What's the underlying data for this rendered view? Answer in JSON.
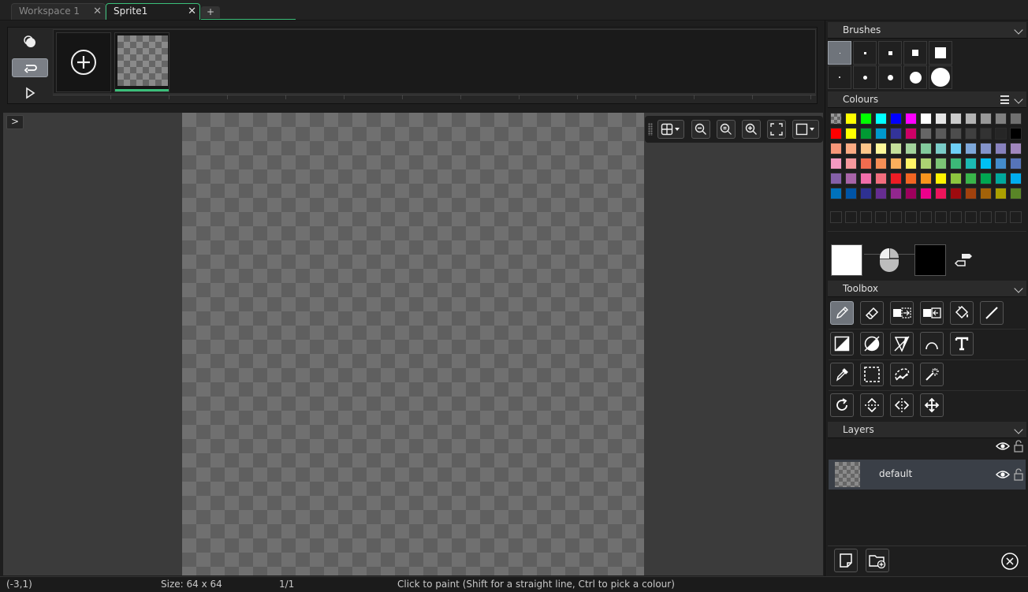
{
  "tabs": [
    {
      "label": "Workspace 1",
      "active": false
    },
    {
      "label": "Sprite1",
      "active": true
    }
  ],
  "tab_add_label": "+",
  "panel_toggle_label": ">",
  "panels": {
    "brushes": {
      "title": "Brushes"
    },
    "colours": {
      "title": "Colours",
      "palette_rows": [
        [
          "transparent",
          "#ffff00",
          "#00ff00",
          "#00ffff",
          "#0000ff",
          "#ff00ff",
          "#ffffff",
          "#e6e6e6",
          "#cccccc",
          "#b3b3b3",
          "#999999",
          "#808080",
          "#707070"
        ],
        [
          "#ff0000",
          "#ffff00",
          "#009933",
          "#0099cc",
          "#333399",
          "#cc0066",
          "#666666",
          "#5a5a5a",
          "#4d4d4d",
          "#404040",
          "#333333",
          "#262626",
          "#000000"
        ],
        [
          "#f79779",
          "#fbab83",
          "#fdc689",
          "#fff79a",
          "#c4df9b",
          "#a3d39c",
          "#82ca9c",
          "#7accc8",
          "#6dcff6",
          "#7da7d9",
          "#8393ca",
          "#8781bd",
          "#a187be"
        ],
        [
          "#f49ac2",
          "#f6989d",
          "#f26c4f",
          "#f68e56",
          "#fbaf5c",
          "#fff467",
          "#acd373",
          "#7cc576",
          "#3cb878",
          "#1cbbb4",
          "#00bff3",
          "#448ccb",
          "#5674b9"
        ],
        [
          "#8560a8",
          "#a864a8",
          "#f06eaa",
          "#f26d7d",
          "#ed1c24",
          "#f26522",
          "#f7941d",
          "#fff200",
          "#8dc63f",
          "#39b54a",
          "#00a651",
          "#00a99d",
          "#00aeef"
        ],
        [
          "#0072bc",
          "#0054a6",
          "#2e3192",
          "#662d91",
          "#92278f",
          "#9e005d",
          "#ec008c",
          "#ed145b",
          "#9e0b0f",
          "#a0410d",
          "#a36209",
          "#aba000",
          "#598527"
        ]
      ],
      "primary_colour": "#ffffff",
      "secondary_colour": "#000000"
    },
    "toolbox": {
      "title": "Toolbox",
      "tools": [
        [
          "pencil-icon",
          "eraser-icon",
          "copy-selection-icon",
          "paste-selection-icon",
          "fill-bucket-icon",
          "line-icon"
        ],
        [
          "rectangle-icon",
          "ellipse-icon",
          "triangle-icon",
          "arc-icon",
          "text-icon"
        ],
        [
          "colour-picker-icon",
          "rect-select-icon",
          "lasso-select-icon",
          "magic-wand-icon"
        ],
        [
          "rotate-icon",
          "flip-vertical-icon",
          "flip-horizontal-icon",
          "move-icon"
        ]
      ]
    },
    "layers": {
      "title": "Layers",
      "items": [
        {
          "name": "default"
        }
      ]
    }
  },
  "status": {
    "coords": "(-3,1)",
    "size": "Size: 64 x 64",
    "frame": "1/1",
    "hint": "Click to paint (Shift for a straight line, Ctrl to pick a colour)"
  }
}
